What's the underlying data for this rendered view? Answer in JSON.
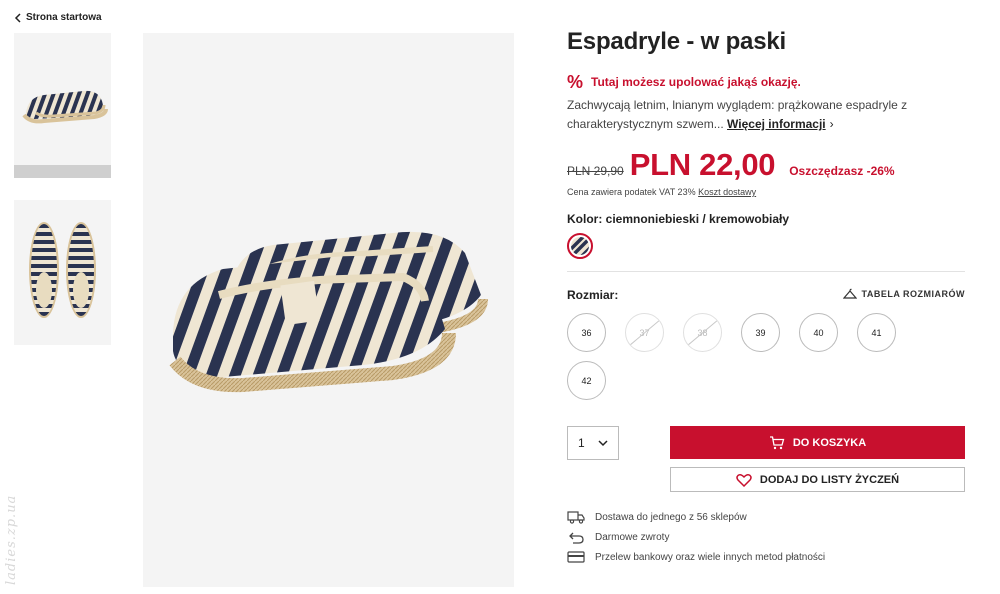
{
  "nav": {
    "back_label": "Strona startowa"
  },
  "watermark": "ladies.zp.ua",
  "product": {
    "title": "Espadryle - w paski",
    "deal_icon": "%",
    "deal_text": "Tutaj możesz upolować jakąś okazję.",
    "description": "Zachwycają letnim, lnianym wyglądem: prążkowane espadryle z charakterystycznym szwem...",
    "more_info_label": "Więcej informacji",
    "old_price": "PLN 29,90",
    "price": "PLN 22,00",
    "saving": "Oszczędzasz -26%",
    "vat_text": "Cena zawiera podatek VAT 23%",
    "shipping_link": "Koszt dostawy",
    "color_label": "Kolor: ciemnoniebieski / kremowobiały",
    "size_label": "Rozmiar:",
    "size_table_label": "TABELA ROZMIARÓW",
    "sizes": [
      {
        "label": "36",
        "available": true
      },
      {
        "label": "37",
        "available": false
      },
      {
        "label": "38",
        "available": false
      },
      {
        "label": "39",
        "available": true
      },
      {
        "label": "40",
        "available": true
      },
      {
        "label": "41",
        "available": true
      },
      {
        "label": "42",
        "available": true
      }
    ],
    "quantity": "1",
    "add_to_cart_label": "DO KOSZYKA",
    "wishlist_label": "DODAJ DO LISTY ŻYCZEŃ"
  },
  "info": [
    {
      "icon": "truck-icon",
      "text": "Dostawa do jednego z 56 sklepów"
    },
    {
      "icon": "return-arrow-icon",
      "text": "Darmowe zwroty"
    },
    {
      "icon": "credit-card-icon",
      "text": "Przelew bankowy oraz wiele innych metod płatności"
    }
  ],
  "colors": {
    "accent": "#c8102e",
    "navy": "#2a3350",
    "cream": "#efe6d3"
  }
}
